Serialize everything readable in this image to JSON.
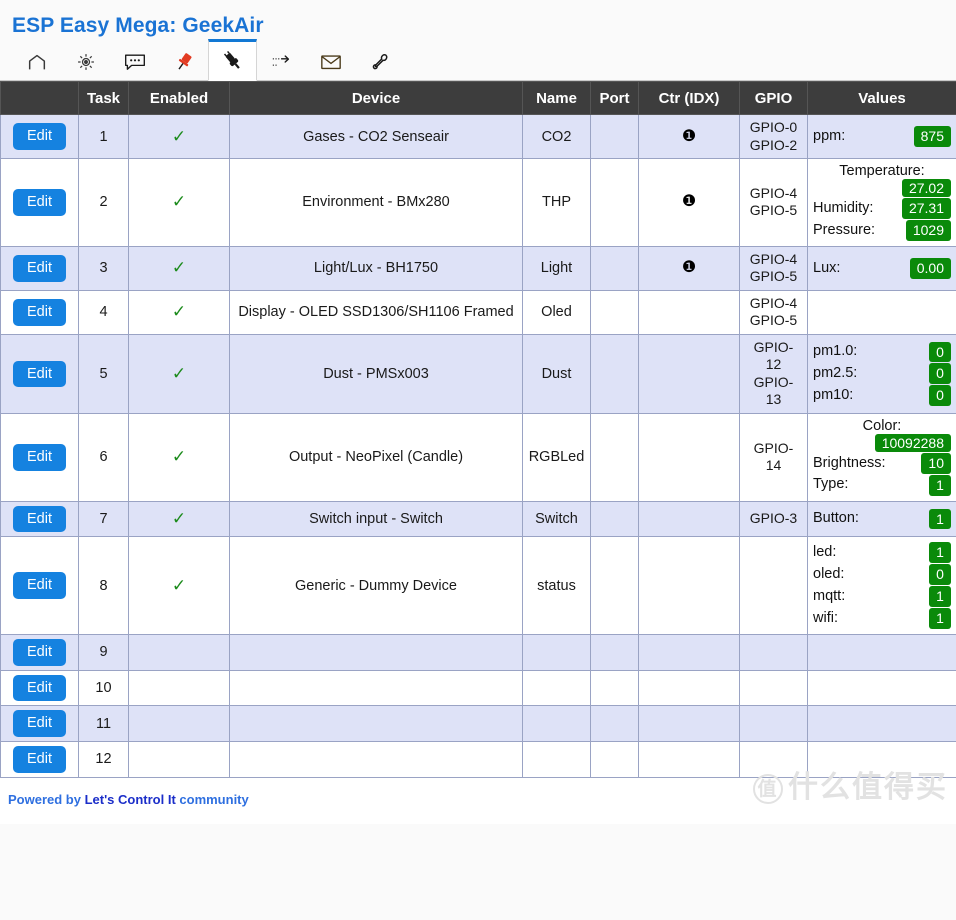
{
  "app": {
    "title": "ESP Easy Mega: GeekAir",
    "title_color": "#1a73d4"
  },
  "tabs": [
    {
      "icon": "home-icon",
      "name": "tab-home",
      "active": false
    },
    {
      "icon": "gear-icon",
      "name": "tab-config",
      "active": false
    },
    {
      "icon": "chat-icon",
      "name": "tab-controllers",
      "active": false
    },
    {
      "icon": "pin-icon",
      "name": "tab-hardware",
      "active": false
    },
    {
      "icon": "plug-icon",
      "name": "tab-devices",
      "active": true
    },
    {
      "icon": "arrow-icon",
      "name": "tab-rules",
      "active": false
    },
    {
      "icon": "mail-icon",
      "name": "tab-notifications",
      "active": false
    },
    {
      "icon": "wrench-icon",
      "name": "tab-tools",
      "active": false
    }
  ],
  "table": {
    "headers": [
      "",
      "Task",
      "Enabled",
      "Device",
      "Name",
      "Port",
      "Ctr (IDX)",
      "GPIO",
      "Values"
    ],
    "edit_label": "Edit",
    "check_glyph": "✓",
    "ctr_glyph": "❶",
    "rows": [
      {
        "task": "1",
        "enabled": true,
        "device": "Gases - CO2 Senseair",
        "name": "CO2",
        "port": "",
        "ctr": "1",
        "gpio": "GPIO-0\nGPIO-2",
        "values": [
          {
            "label": "ppm:",
            "value": "875",
            "wrap": false
          }
        ]
      },
      {
        "task": "2",
        "enabled": true,
        "device": "Environment - BMx280",
        "name": "THP",
        "port": "",
        "ctr": "1",
        "gpio": "GPIO-4\nGPIO-5",
        "values": [
          {
            "label": "Temperature:",
            "value": "27.02",
            "wrap": true
          },
          {
            "label": "Humidity:",
            "value": "27.31",
            "wrap": false
          },
          {
            "label": "Pressure:",
            "value": "1029",
            "wrap": false
          }
        ]
      },
      {
        "task": "3",
        "enabled": true,
        "device": "Light/Lux - BH1750",
        "name": "Light",
        "port": "",
        "ctr": "1",
        "gpio": "GPIO-4\nGPIO-5",
        "values": [
          {
            "label": "Lux:",
            "value": "0.00",
            "wrap": false
          }
        ]
      },
      {
        "task": "4",
        "enabled": true,
        "device": "Display - OLED SSD1306/SH1106 Framed",
        "name": "Oled",
        "port": "",
        "ctr": "",
        "gpio": "GPIO-4\nGPIO-5",
        "values": []
      },
      {
        "task": "5",
        "enabled": true,
        "device": "Dust - PMSx003",
        "name": "Dust",
        "port": "",
        "ctr": "",
        "gpio": "GPIO-\n12\nGPIO-\n13",
        "values": [
          {
            "label": "pm1.0:",
            "value": "0",
            "wrap": false
          },
          {
            "label": "pm2.5:",
            "value": "0",
            "wrap": false
          },
          {
            "label": "pm10:",
            "value": "0",
            "wrap": false
          }
        ]
      },
      {
        "task": "6",
        "enabled": true,
        "device": "Output - NeoPixel (Candle)",
        "name": "RGBLed",
        "port": "",
        "ctr": "",
        "gpio": "GPIO-\n14",
        "values": [
          {
            "label": "Color:",
            "value": "10092288",
            "wrap": true
          },
          {
            "label": "Brightness:",
            "value": "10",
            "wrap": false
          },
          {
            "label": "Type:",
            "value": "1",
            "wrap": false
          }
        ]
      },
      {
        "task": "7",
        "enabled": true,
        "device": "Switch input - Switch",
        "name": "Switch",
        "port": "",
        "ctr": "",
        "gpio": "GPIO-3",
        "values": [
          {
            "label": "Button:",
            "value": "1",
            "wrap": false
          }
        ]
      },
      {
        "task": "8",
        "enabled": true,
        "device": "Generic - Dummy Device",
        "name": "status",
        "port": "",
        "ctr": "",
        "gpio": "",
        "values": [
          {
            "label": "led:",
            "value": "1",
            "wrap": false
          },
          {
            "label": "oled:",
            "value": "0",
            "wrap": false
          },
          {
            "label": "mqtt:",
            "value": "1",
            "wrap": false
          },
          {
            "label": "wifi:",
            "value": "1",
            "wrap": false
          }
        ]
      },
      {
        "task": "9",
        "enabled": false,
        "device": "",
        "name": "",
        "port": "",
        "ctr": "",
        "gpio": "",
        "values": []
      },
      {
        "task": "10",
        "enabled": false,
        "device": "",
        "name": "",
        "port": "",
        "ctr": "",
        "gpio": "",
        "values": []
      },
      {
        "task": "11",
        "enabled": false,
        "device": "",
        "name": "",
        "port": "",
        "ctr": "",
        "gpio": "",
        "values": []
      },
      {
        "task": "12",
        "enabled": false,
        "device": "",
        "name": "",
        "port": "",
        "ctr": "",
        "gpio": "",
        "values": []
      }
    ]
  },
  "footer": {
    "prefix": "Powered by ",
    "brand": "Let's Control It",
    "suffix": " community"
  },
  "watermark": {
    "circle_char": "值",
    "text": "什么值得买"
  },
  "colors": {
    "accent": "#1582e0",
    "header_bg": "#3d3d3d",
    "row_odd": "#dee2f7",
    "badge_green": "#0a8a0a",
    "check_green": "#1c8b1c"
  }
}
